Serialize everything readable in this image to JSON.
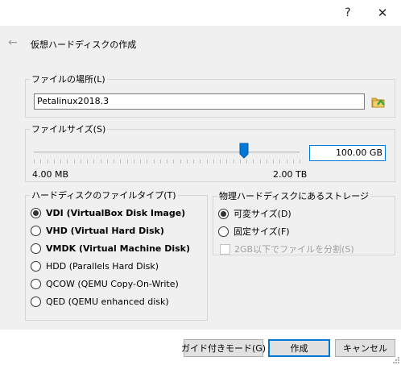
{
  "titlebar": {
    "help_label": "?",
    "close_label": "✕"
  },
  "dialog": {
    "back_icon": "back-arrow-icon",
    "title": "仮想ハードディスクの作成"
  },
  "file_location": {
    "legend": "ファイルの場所(L)",
    "value": "Petalinux2018.3",
    "folder_icon": "folder-browse-icon"
  },
  "file_size": {
    "legend": "ファイルサイズ(S)",
    "min_label": "4.00 MB",
    "max_label": "2.00 TB",
    "value": "100.00 GB",
    "slider_fraction": 0.79
  },
  "disk_type": {
    "legend": "ハードディスクのファイルタイプ(T)",
    "options": [
      {
        "label": "VDI (VirtualBox Disk Image)",
        "selected": true,
        "bold": true
      },
      {
        "label": "VHD (Virtual Hard Disk)",
        "selected": false,
        "bold": true
      },
      {
        "label": "VMDK (Virtual Machine Disk)",
        "selected": false,
        "bold": true
      },
      {
        "label": "HDD (Parallels Hard Disk)",
        "selected": false,
        "bold": false
      },
      {
        "label": "QCOW (QEMU Copy-On-Write)",
        "selected": false,
        "bold": false
      },
      {
        "label": "QED (QEMU enhanced disk)",
        "selected": false,
        "bold": false
      }
    ]
  },
  "storage": {
    "legend": "物理ハードディスクにあるストレージ",
    "options": [
      {
        "label": "可変サイズ(D)",
        "selected": true
      },
      {
        "label": "固定サイズ(F)",
        "selected": false
      }
    ],
    "split_label": "2GB以下でファイルを分割(S)",
    "split_checked": false,
    "split_enabled": false
  },
  "buttons": {
    "guided_mode": "ガイド付きモード(G)",
    "create": "作成",
    "cancel": "キャンセル"
  },
  "colors": {
    "accent": "#0078d7",
    "folder": "#e8b84a",
    "folder_arrow": "#3aa63a"
  }
}
